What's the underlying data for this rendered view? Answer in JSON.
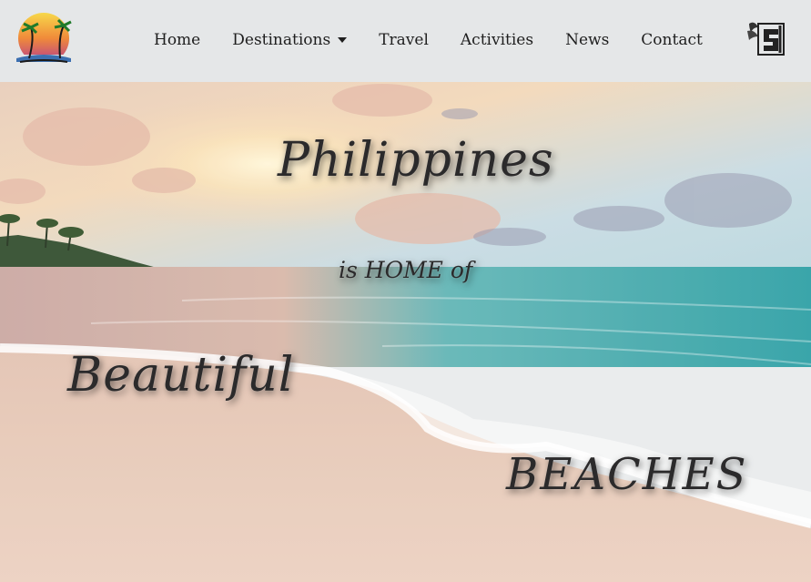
{
  "navbar": {
    "brand_icon": "sunset-palm-island-icon",
    "links": [
      {
        "label": "Home"
      },
      {
        "label": "Destinations",
        "has_dropdown": true
      },
      {
        "label": "Travel"
      },
      {
        "label": "Activities"
      },
      {
        "label": "News"
      },
      {
        "label": "Contact"
      }
    ],
    "right_logo_icon": "winged-monogram-logo-icon"
  },
  "hero": {
    "line1": "Philippines",
    "line2": "is HOME of",
    "line3": "Beautiful",
    "line4": "BEACHES",
    "background": "beach-sunset-photo"
  },
  "colors": {
    "navbar_bg": "#e5e7e8",
    "nav_text": "#1e1e1e",
    "hero_text": "#2b2a2b",
    "sea": "#3aa7a8",
    "sand": "#e8c8b6",
    "sky": "#c9dde3"
  }
}
